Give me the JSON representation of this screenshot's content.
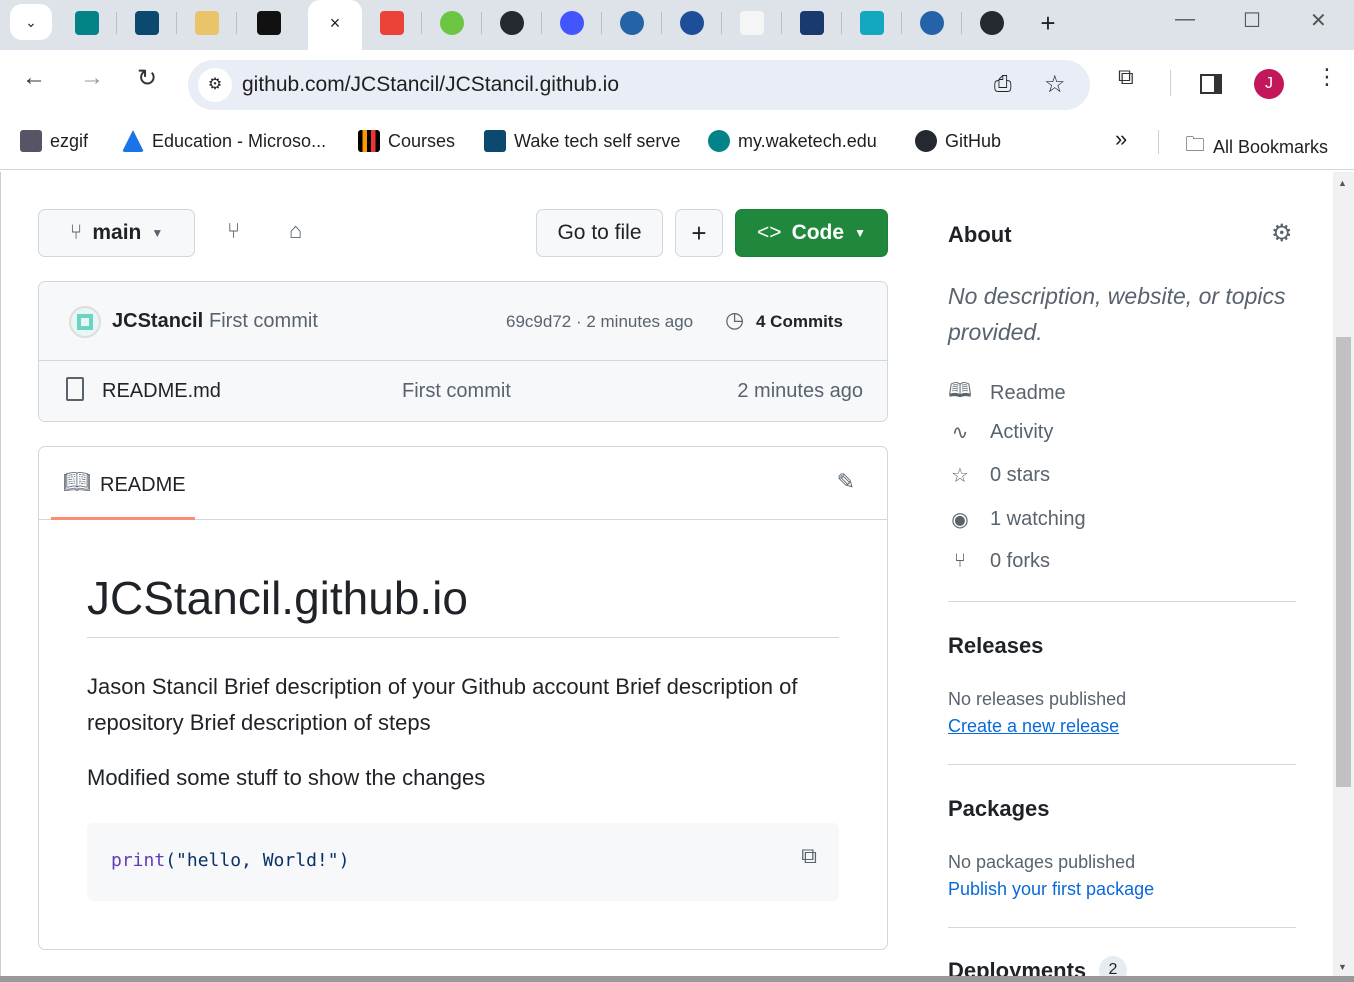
{
  "browser": {
    "tabs": [
      "sharepoint",
      "wake-tech",
      "books",
      "courses",
      "github-active",
      "gmail",
      "github-green",
      "github",
      "quizlet",
      "wt-logo",
      "wt-seal",
      "shortcuts",
      "iris",
      "p-app",
      "wt-logo2",
      "github2"
    ],
    "active_tab_close": "×",
    "new_tab": "+",
    "url": "github.com/JCStancil/JCStancil.github.io",
    "avatar_letter": "J",
    "bookmarks": [
      "ezgif",
      "Education - Microso...",
      "Courses",
      "Wake tech self serve",
      "my.waketech.edu",
      "GitHub"
    ],
    "more_bookmarks": "»",
    "all_bookmarks": "All Bookmarks"
  },
  "repo": {
    "branch": "main",
    "goto_file": "Go to file",
    "add": "+",
    "code": "Code",
    "commit": {
      "author": "JCStancil",
      "message": "First commit",
      "hash_time": "69c9d72 · 2 minutes ago",
      "commits": "4 Commits"
    },
    "files": [
      {
        "name": "README.md",
        "message": "First commit",
        "time": "2 minutes ago"
      }
    ]
  },
  "readme": {
    "tab": "README",
    "title": "JCStancil.github.io",
    "p1": "Jason Stancil Brief description of your Github account Brief description of repository Brief description of steps",
    "p2": "Modified some stuff to show the changes",
    "code": {
      "fn": "print",
      "args": "(\"hello, World!\")"
    }
  },
  "about": {
    "title": "About",
    "description": "No description, website, or topics provided.",
    "items": [
      "Readme",
      "Activity",
      "0 stars",
      "1 watching",
      "0 forks"
    ],
    "releases": {
      "title": "Releases",
      "none": "No releases published",
      "link": "Create a new release"
    },
    "packages": {
      "title": "Packages",
      "none": "No packages published",
      "link": "Publish your first package"
    },
    "deployments": {
      "title": "Deployments",
      "count": "2"
    }
  },
  "colors": {
    "green": "#1f883d",
    "link": "#0969da",
    "underline": "#fd8c73"
  }
}
